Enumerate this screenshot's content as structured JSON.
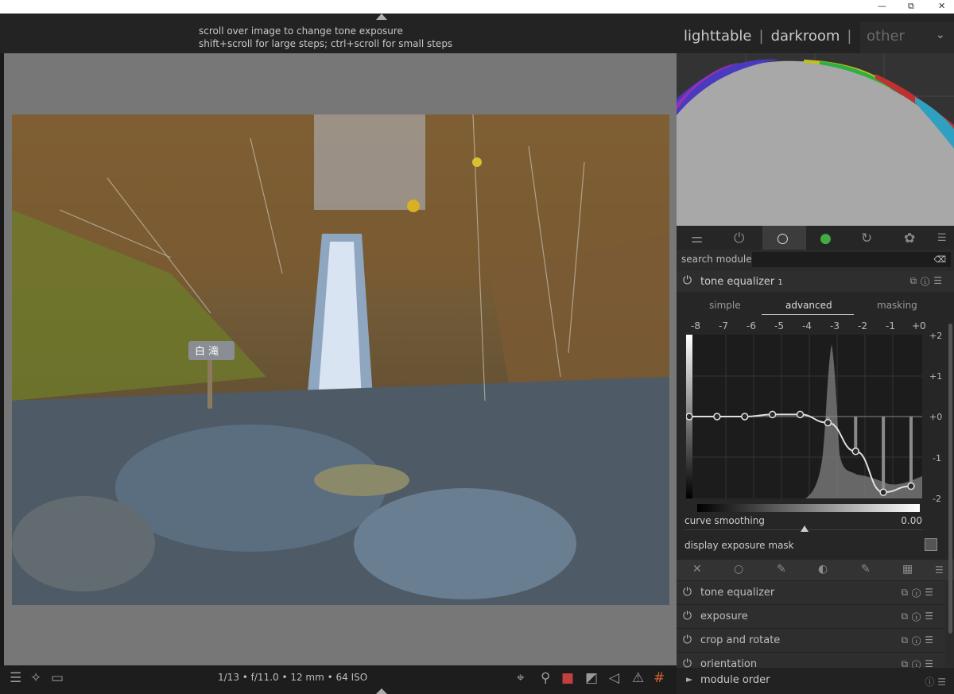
{
  "window": {
    "minimize": "—",
    "restore": "⧉",
    "close": "✕"
  },
  "hint": {
    "line1": "scroll over image to change tone exposure",
    "line2": "shift+scroll for large steps; ctrl+scroll for small steps"
  },
  "views": {
    "lighttable": "lighttable",
    "sep1": "|",
    "darkroom": "darkroom",
    "sep2": "|",
    "other": "other"
  },
  "bottom": {
    "exif": "1/13 • f/11.0 • 12 mm • 64 ISO"
  },
  "search": {
    "label": "search module"
  },
  "module": {
    "title": "tone equalizer",
    "instance": "1",
    "tabs": [
      "simple",
      "advanced",
      "masking"
    ],
    "active_tab": "advanced",
    "x_ticks": [
      "-8",
      "-7",
      "-6",
      "-5",
      "-4",
      "-3",
      "-2",
      "-1",
      "+0"
    ],
    "y_ticks": [
      "+2",
      "+1",
      "+0",
      "-1",
      "-2"
    ],
    "curve_nodes_ev": [
      0,
      0,
      0,
      0.05,
      0.05,
      -0.15,
      -0.85,
      -1.85,
      -1.7
    ],
    "curve_smoothing_label": "curve smoothing",
    "curve_smoothing_value": "0.00",
    "mask_label": "display exposure mask"
  },
  "modules": [
    {
      "title": "tone equalizer"
    },
    {
      "title": "exposure"
    },
    {
      "title": "crop and rotate"
    },
    {
      "title": "orientation"
    }
  ],
  "module_order": "module order",
  "colors": {
    "accent": "#cccccc",
    "panel": "#2b2b2b",
    "canvas": "#777777"
  }
}
